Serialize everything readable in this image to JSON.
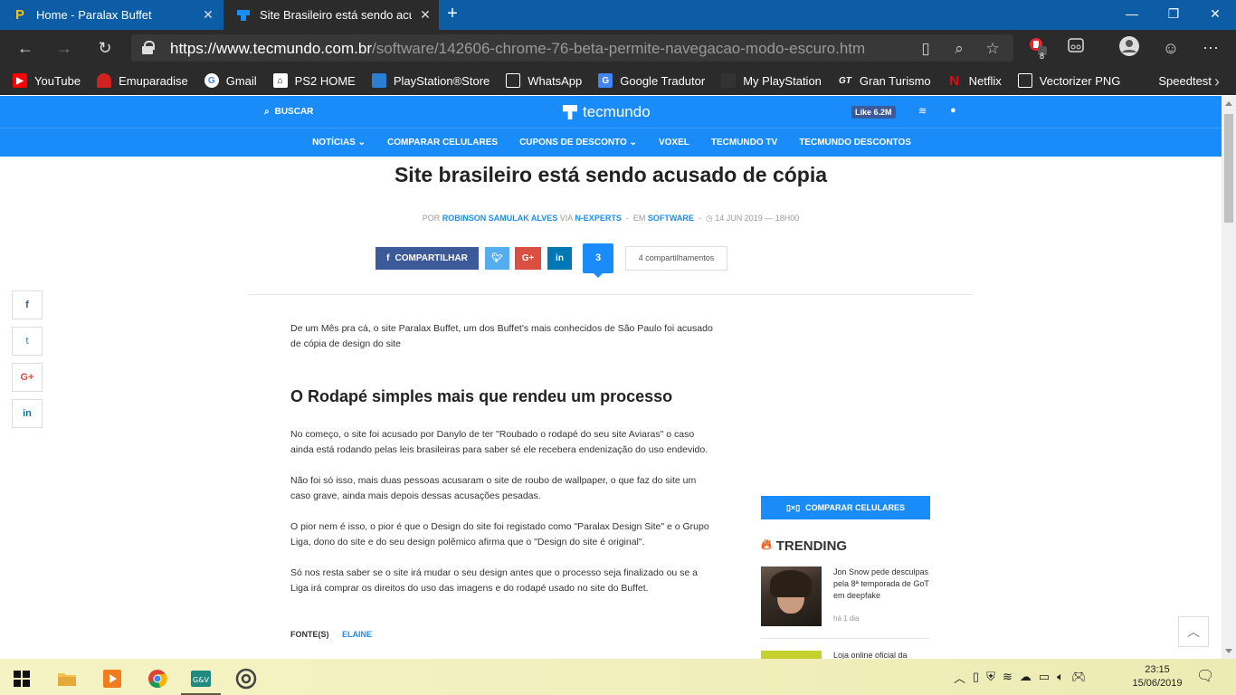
{
  "browser": {
    "tabs": [
      {
        "title": "Home - Paralax Buffet",
        "favicon": "P",
        "active": false
      },
      {
        "title": "Site Brasileiro está sendo acusad",
        "active": true
      }
    ],
    "url_host": "https://www.tecmundo.com.br",
    "url_path": "/software/142606-chrome-76-beta-permite-navegacao-modo-escuro.htm",
    "extension_badge": "8",
    "bookmarks": [
      {
        "label": "YouTube",
        "icon": "youtube-icon",
        "color": "#ff0000"
      },
      {
        "label": "Emuparadise",
        "icon": "mushroom-icon",
        "color": "#d0231f"
      },
      {
        "label": "Gmail",
        "icon": "google-icon",
        "color": "#ffffff"
      },
      {
        "label": "PS2 HOME",
        "icon": "house-icon",
        "color": "#ffffff"
      },
      {
        "label": "PlayStation®Store",
        "icon": "store-icon",
        "color": "#2a7fd4"
      },
      {
        "label": "WhatsApp",
        "icon": "page-icon",
        "color": "#ffffff"
      },
      {
        "label": "Google Tradutor",
        "icon": "translate-icon",
        "color": "#4285f4"
      },
      {
        "label": "My PlayStation",
        "icon": "playstation-icon",
        "color": "#333333"
      },
      {
        "label": "Gran Turismo",
        "icon": "gt-icon",
        "color": "#ffffff"
      },
      {
        "label": "Netflix",
        "icon": "netflix-icon",
        "color": "#e50914"
      },
      {
        "label": "Vectorizer PNG",
        "icon": "page-icon",
        "color": "#ffffff"
      },
      {
        "label": "Speedtest",
        "icon": "speed-icon",
        "color": "#2b2b2b"
      }
    ]
  },
  "site": {
    "search_label": "BUSCAR",
    "logo_text": "tecmundo",
    "like_label": "Like 6.2M",
    "menu": [
      "NOTÍCIAS ⌄",
      "COMPARAR CELULARES",
      "CUPONS DE DESCONTO ⌄",
      "VOXEL",
      "TECMUNDO TV",
      "TECMUNDO DESCONTOS"
    ]
  },
  "article": {
    "title": "Site brasileiro está sendo acusado de cópia",
    "byline_prefix": "POR",
    "author": "ROBINSON SAMULAK ALVES",
    "via_prefix": "VIA",
    "via": "N-EXPERTS",
    "category_prefix": "EM",
    "category": "SOFTWARE",
    "date": "14 JUN 2019 — 18H00",
    "share_label": "COMPARTILHAR",
    "comment_count": "3",
    "share_count": "4 compartilhamentos",
    "lead": "De um Mês pra cá, o site Paralax Buffet, um dos Buffet's mais conhecidos de São Paulo foi acusado de cópia de design do site",
    "subhead": "O Rodapé simples mais que rendeu um processo",
    "paragraphs": [
      "No começo, o site foi acusado por Danylo de ter \"Roubado o rodapé do seu site Aviaras\" o caso ainda está rodando pelas leis brasileiras para saber sé ele recebera endenização do uso endevido.",
      "Não foi só isso, mais duas pessoas acusaram o site de roubo de wallpaper, o que faz do site um caso grave, ainda mais depois dessas acusações pesadas.",
      "O pior nem é isso, o pior é que o Design do site foi registado como \"Paralax Design Site\" e o Grupo Liga, dono do site e do seu design polêmico afirma que o \"Design do site é original\".",
      "Só nos resta saber se o site irá mudar o seu design antes que o processo seja finalizado ou se a Liga irá comprar os direitos do uso das imagens e do rodapé usado no site do Buffet."
    ],
    "sources_label": "FONTE(S)",
    "source": "ELAINE"
  },
  "sidebar": {
    "compare_label": "COMPARAR CELULARES",
    "trending_label": "TRENDING",
    "trending": [
      {
        "title": "Jon Snow pede desculpas pela 8ª temporada de GoT em deepfake",
        "age": "há 1 dia"
      },
      {
        "title": "Loja online oficial da"
      }
    ]
  },
  "taskbar": {
    "time": "23:15",
    "date": "15/06/2019"
  },
  "colors": {
    "brand": "#1a8cfa",
    "titlebar": "#0c5ca6",
    "facebook": "#3c5a99",
    "twitter": "#55acee",
    "googleplus": "#dc4e41",
    "linkedin": "#0077b5"
  }
}
